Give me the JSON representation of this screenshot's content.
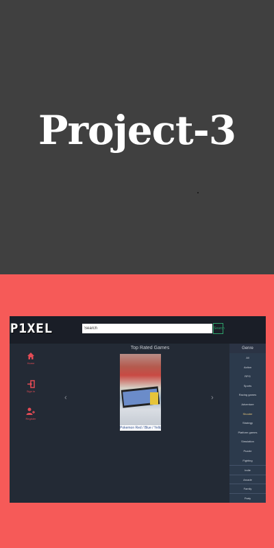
{
  "hero": {
    "title": "Project-3"
  },
  "app": {
    "logo": "P1XEL",
    "search": {
      "placeholder": "Search",
      "value": "Search",
      "button_label": "Search"
    },
    "nav": [
      {
        "label": "Home",
        "icon": "home-icon"
      },
      {
        "label": "Sign in",
        "icon": "sign-in-icon"
      },
      {
        "label": "Register",
        "icon": "add-user-icon"
      }
    ],
    "main": {
      "title": "Top Rated Games",
      "featured": {
        "caption": "Pokemon Red / Blue / Yellow"
      },
      "prev_arrow": "‹",
      "next_arrow": "›"
    },
    "sidebar": {
      "header": "Genre",
      "items": [
        "All",
        "Action",
        "RPG",
        "Sports",
        "Racing games",
        "Adventure",
        "Shooter",
        "Strategy",
        "Platform games",
        "Simulation",
        "Puzzle",
        "Fighting",
        "Indie",
        "Arcade",
        "Family",
        "Party"
      ]
    }
  }
}
